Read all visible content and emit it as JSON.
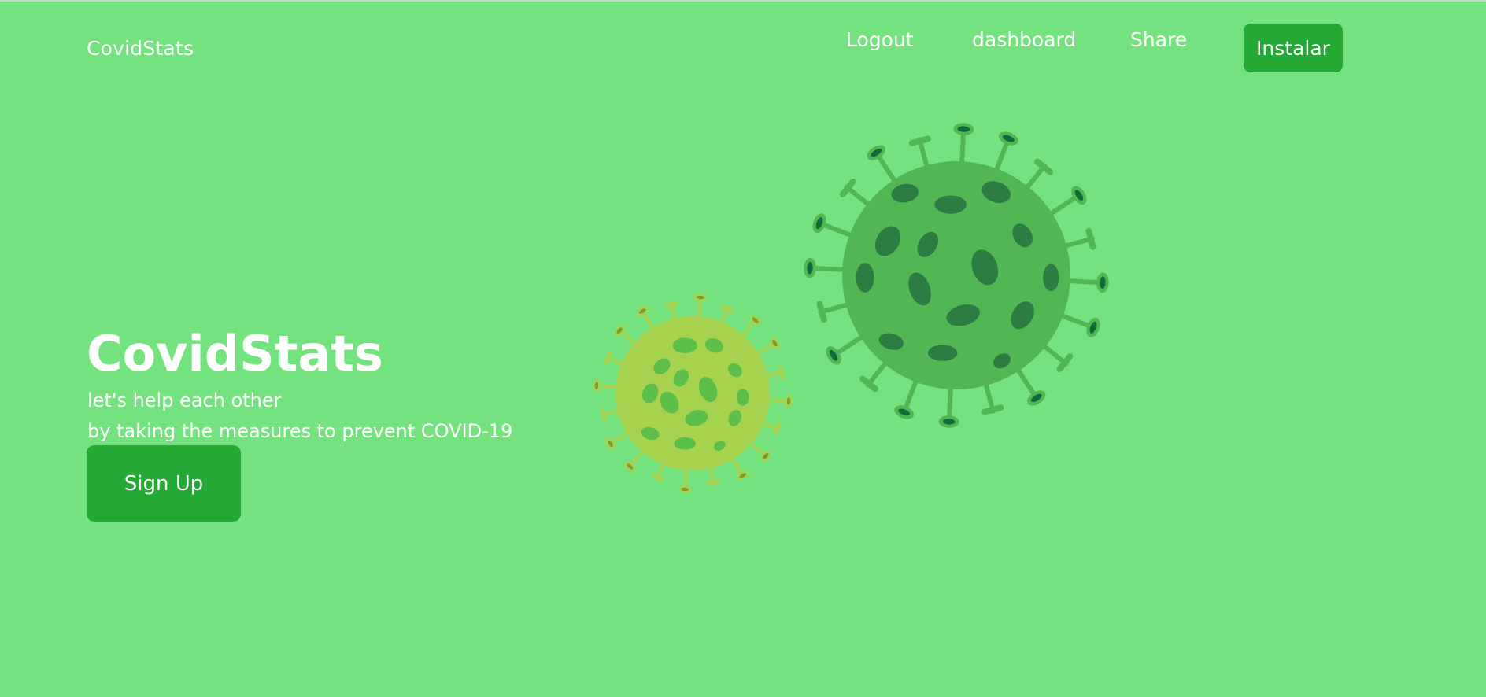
{
  "navbar": {
    "brand": "CovidStats",
    "links": [
      "Logout",
      "dashboard",
      "Share"
    ],
    "install_label": "Instalar"
  },
  "hero": {
    "title": "CovidStats",
    "line1": "let's help each other",
    "line2": "by taking the measures to prevent COVID-19",
    "signup_label": "Sign Up"
  },
  "illustration": {
    "icons": [
      "virus-small-icon",
      "virus-large-icon"
    ],
    "colors": {
      "background": "#74e27f",
      "button": "#24a934",
      "virus_small_body": "#a7d24e",
      "virus_small_spots": "#5cbf4a",
      "virus_large_body": "#52b752",
      "virus_large_spots": "#2e7c43",
      "spike_tip": "#0f6b3a"
    }
  }
}
